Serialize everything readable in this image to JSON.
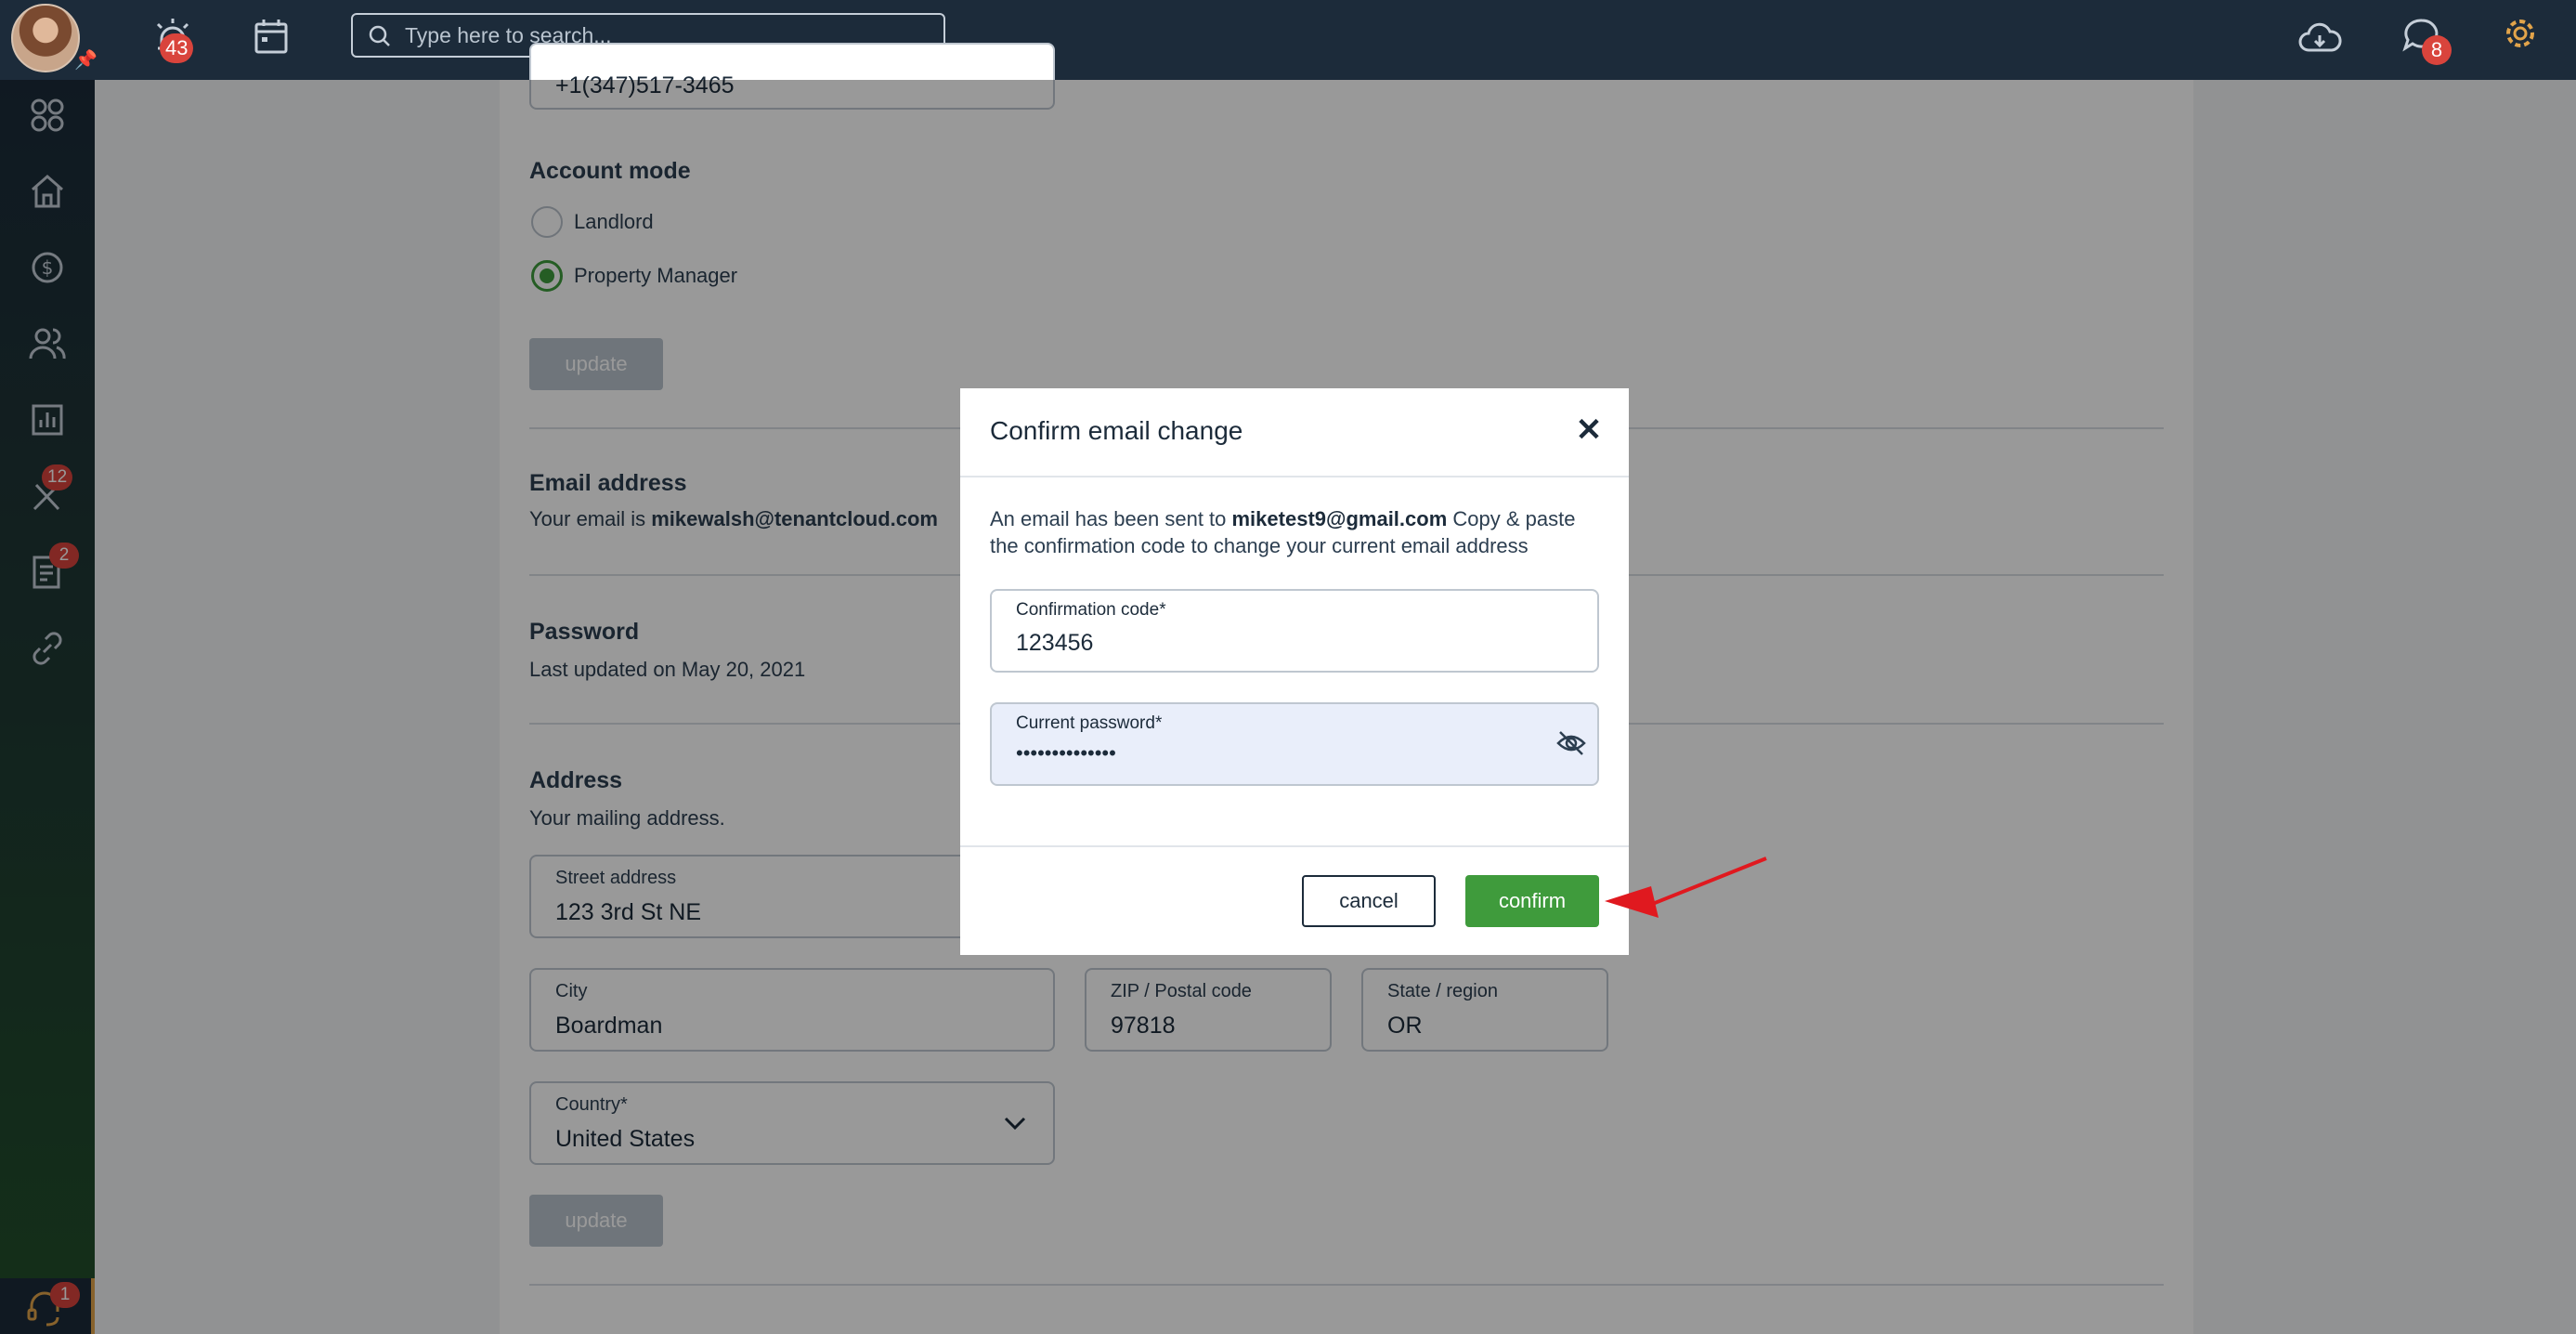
{
  "topbar": {
    "notifications_badge": "43",
    "search_placeholder": "Type here to search...",
    "messages_badge": "8"
  },
  "sidebar": {
    "tools_badge": "12",
    "documents_badge": "2",
    "support_badge": "1"
  },
  "profile": {
    "phone_value": "+1(347)517-3465",
    "account_mode": {
      "title": "Account mode",
      "options": [
        "Landlord",
        "Property Manager"
      ],
      "selected": "Property Manager",
      "update_label": "update"
    },
    "email": {
      "title": "Email address",
      "prefix": "Your email is ",
      "value": "mikewalsh@tenantcloud.com"
    },
    "password": {
      "title": "Password",
      "updated": "Last updated on May 20, 2021"
    },
    "address": {
      "title": "Address",
      "subtitle": "Your mailing address.",
      "street_label": "Street address",
      "street_value": "123 3rd St NE",
      "city_label": "City",
      "city_value": "Boardman",
      "zip_label": "ZIP / Postal code",
      "zip_value": "97818",
      "state_label": "State / region",
      "state_value": "OR",
      "country_label": "Country*",
      "country_value": "United States",
      "update_label": "update"
    }
  },
  "modal": {
    "title": "Confirm email change",
    "message_prefix": "An email has been sent to ",
    "message_email": "miketest9@gmail.com",
    "message_suffix": " Copy & paste the confirmation code to change your current email address",
    "code_label": "Confirmation code*",
    "code_value": "123456",
    "password_label": "Current password*",
    "password_value": "••••••••••••••",
    "cancel_label": "cancel",
    "confirm_label": "confirm"
  },
  "colors": {
    "topbar": "#1c2b3a",
    "accent_green": "#3f9b3c",
    "badge_red": "#d9443c",
    "settings_orange": "#e2a44a",
    "annotation_red": "#e0191f"
  }
}
